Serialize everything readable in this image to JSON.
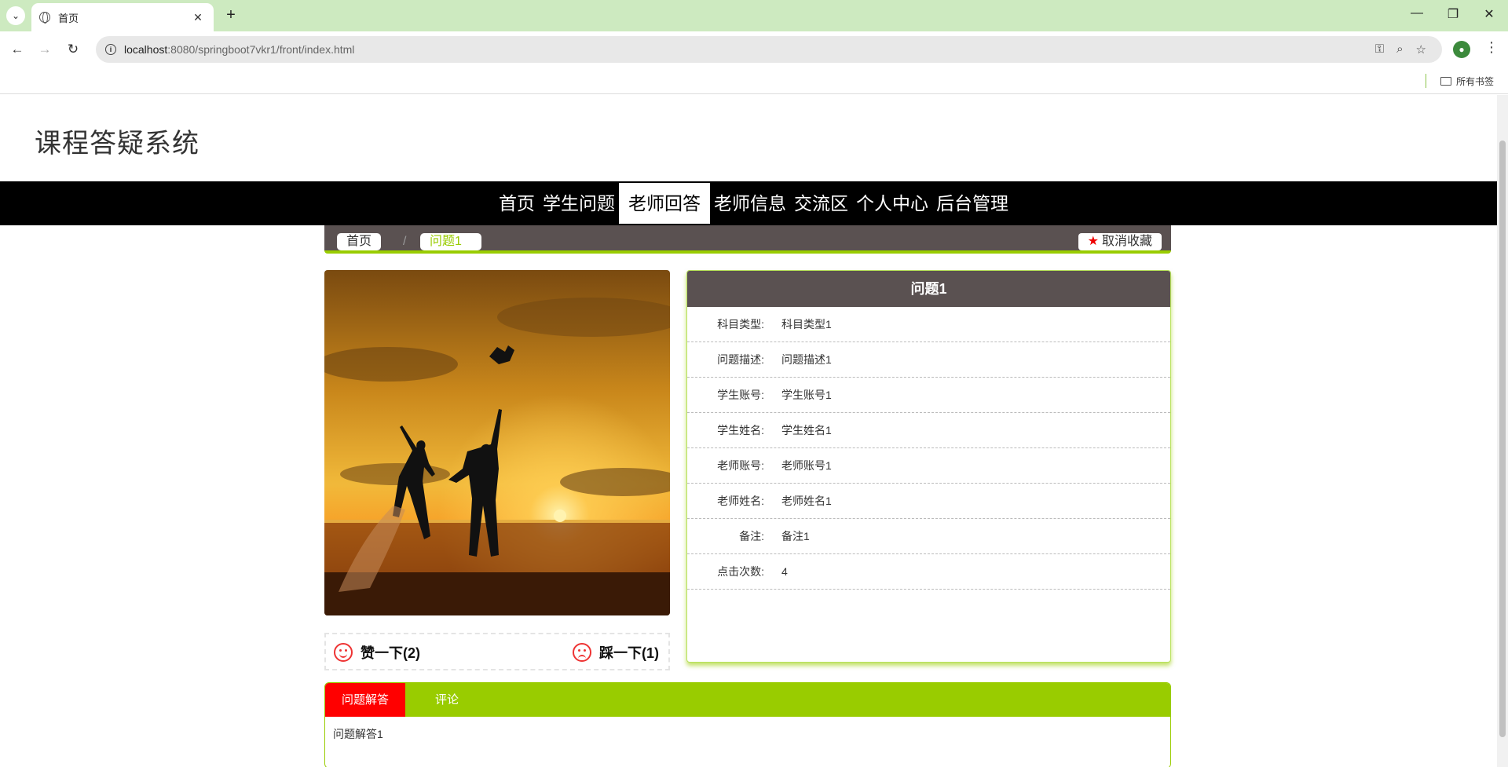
{
  "browser": {
    "tab_title": "首页",
    "url_host": "localhost",
    "url_rest": ":8080/springboot7vkr1/front/index.html",
    "bookmarks_all": "所有书签"
  },
  "site": {
    "title": "课程答疑系统",
    "nav": [
      "首页",
      "学生问题",
      "老师回答",
      "老师信息",
      "交流区",
      "个人中心",
      "后台管理"
    ],
    "nav_active_index": 2
  },
  "breadcrumb": {
    "home": "首页",
    "separator": "/",
    "current": "问题1",
    "favorite_button": "取消收藏"
  },
  "votes": {
    "up_label": "赞一下(2)",
    "down_label": "踩一下(1)"
  },
  "detail": {
    "title": "问题1",
    "rows": [
      {
        "label": "科目类型:",
        "value": "科目类型1"
      },
      {
        "label": "问题描述:",
        "value": "问题描述1"
      },
      {
        "label": "学生账号:",
        "value": "学生账号1"
      },
      {
        "label": "学生姓名:",
        "value": "学生姓名1"
      },
      {
        "label": "老师账号:",
        "value": "老师账号1"
      },
      {
        "label": "老师姓名:",
        "value": "老师姓名1"
      },
      {
        "label": "备注:",
        "value": "备注1"
      },
      {
        "label": "点击次数:",
        "value": "4"
      }
    ]
  },
  "tabs": {
    "items": [
      "问题解答",
      "评论"
    ],
    "active_index": 0,
    "content": "问题解答1"
  },
  "colors": {
    "accent_green": "#99cc00",
    "header_brown": "#5a5151",
    "nav_black": "#000000",
    "active_tab_red": "#ff0000"
  }
}
